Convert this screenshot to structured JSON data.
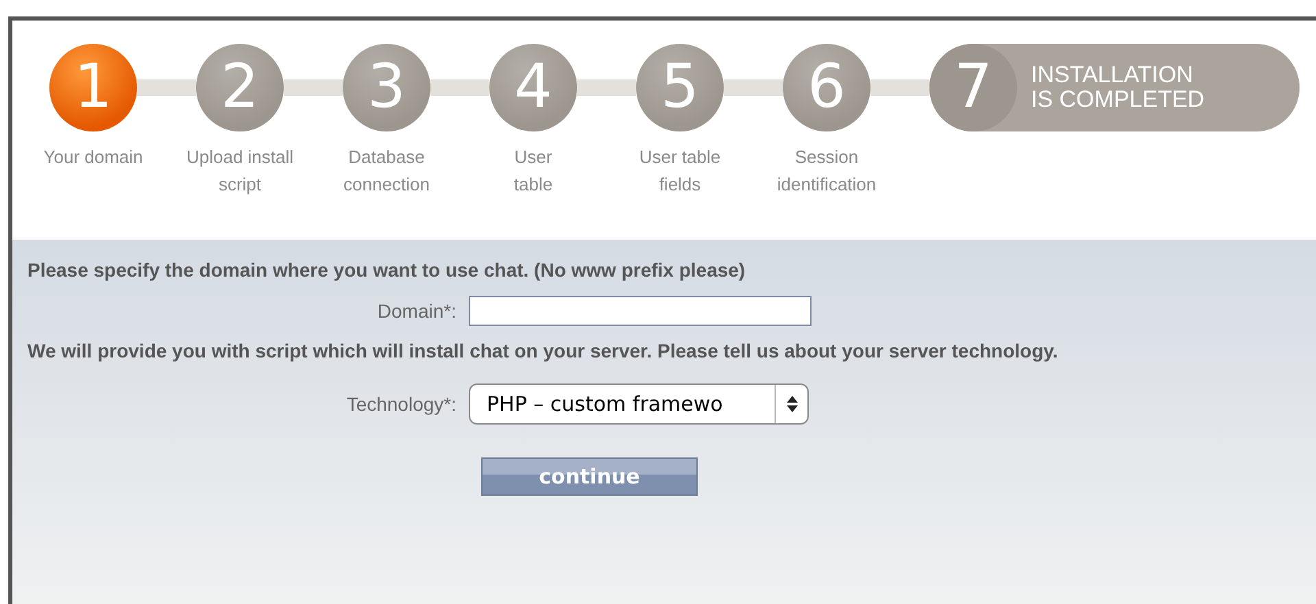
{
  "steps": [
    {
      "kind": "circle",
      "number": "1",
      "label_lines": [
        "Your domain"
      ],
      "selected": true
    },
    {
      "kind": "circle",
      "number": "2",
      "label_lines": [
        "Upload install",
        "script"
      ],
      "selected": false
    },
    {
      "kind": "circle",
      "number": "3",
      "label_lines": [
        "Database",
        "connection"
      ],
      "selected": false
    },
    {
      "kind": "circle",
      "number": "4",
      "label_lines": [
        "User",
        "table"
      ],
      "selected": false
    },
    {
      "kind": "circle",
      "number": "5",
      "label_lines": [
        "User table",
        "fields"
      ],
      "selected": false
    },
    {
      "kind": "circle",
      "number": "6",
      "label_lines": [
        "Session",
        "identification"
      ],
      "selected": false
    },
    {
      "kind": "pill",
      "number": "7",
      "text_lines": [
        "INSTALLATION",
        "IS COMPLETED"
      ],
      "selected": false
    }
  ],
  "form": {
    "intro": "Please specify the domain where you want to use chat. (No www prefix please)",
    "domain_label": "Domain*:",
    "tech_intro": "We will provide you with script which will install chat on your server. Please tell us about your server technology.",
    "tech_label": "Technology*:",
    "tech_value": "PHP – custom framewo",
    "submit": "continue"
  }
}
